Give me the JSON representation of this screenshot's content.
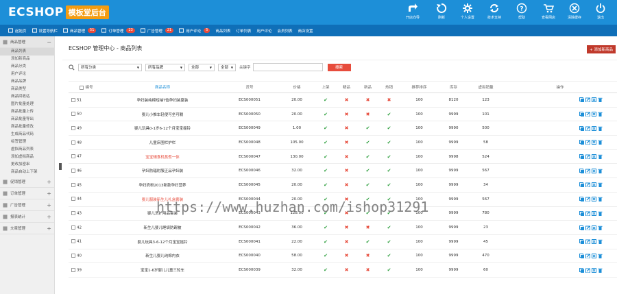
{
  "app": {
    "brand": "ECSHOP",
    "tag": "模板堂后台"
  },
  "top_buttons": [
    {
      "label": "开店向导",
      "icon": "share-icon"
    },
    {
      "label": "刷新",
      "icon": "refresh-icon"
    },
    {
      "label": "个人设置",
      "icon": "gear-icon"
    },
    {
      "label": "技术支持",
      "icon": "sync-icon"
    },
    {
      "label": "帮助",
      "icon": "help-icon"
    },
    {
      "label": "查看网店",
      "icon": "cart-icon"
    },
    {
      "label": "清除缓存",
      "icon": "clear-icon"
    },
    {
      "label": "退出",
      "icon": "power-icon"
    }
  ],
  "nav": [
    {
      "label": "起始页",
      "badge": ""
    },
    {
      "label": "设置导航栏",
      "badge": ""
    },
    {
      "label": "商品管理",
      "badge": "51"
    },
    {
      "label": "订单管理",
      "badge": "23"
    },
    {
      "label": "广告管理",
      "badge": "21"
    },
    {
      "label": "用户评论",
      "badge": "5"
    },
    {
      "label": "商品列表",
      "badge": ""
    },
    {
      "label": "订单列表",
      "badge": ""
    },
    {
      "label": "用户评论",
      "badge": ""
    },
    {
      "label": "会员列表",
      "badge": ""
    },
    {
      "label": "商店设置",
      "badge": ""
    }
  ],
  "sidebar": {
    "groups": [
      {
        "label": "商品管理",
        "expanded": true,
        "sub": [
          "商品列表",
          "添加新商品",
          "商品分类",
          "用户评论",
          "商品品牌",
          "商品类型",
          "商品回收站",
          "图片批量处理",
          "商品批量上传",
          "商品批量导出",
          "商品批量修改",
          "生成商品代码",
          "标签管理",
          "虚拟商品列表",
          "添加虚拟商品",
          "更改加密串",
          "商品自动上下架"
        ]
      },
      {
        "label": "促销管理",
        "expanded": false,
        "sub": []
      },
      {
        "label": "订单管理",
        "expanded": false,
        "sub": []
      },
      {
        "label": "广告管理",
        "expanded": false,
        "sub": []
      },
      {
        "label": "报表统计",
        "expanded": false,
        "sub": []
      },
      {
        "label": "文章管理",
        "expanded": false,
        "sub": []
      }
    ]
  },
  "page": {
    "title": "ECSHOP 管理中心 - 商品列表",
    "add_button": "+ 添加新商品"
  },
  "filter": {
    "category": "所有分类",
    "brand": "所有品牌",
    "status1": "全部",
    "status2": "全部",
    "keyword_label": "关键字",
    "keyword_value": "",
    "search_button": "搜索"
  },
  "table": {
    "headers": [
      "编号",
      "商品名称",
      "货号",
      "价格",
      "上架",
      "精品",
      "新品",
      "热销",
      "推荐排序",
      "库存",
      "虚拟销量",
      "操作"
    ],
    "rows": [
      {
        "id": "51",
        "name": "孕妇装纯棉短袖T恤孕妇装夏装",
        "sn": "ECS000051",
        "price": "20.00",
        "flags": [
          1,
          0,
          0,
          0
        ],
        "sort": "100",
        "stock": "8120",
        "sales": "123",
        "red": false
      },
      {
        "id": "50",
        "name": "婴儿小推车轻便可坐可躺",
        "sn": "ECS000050",
        "price": "20.00",
        "flags": [
          1,
          0,
          0,
          1
        ],
        "sort": "100",
        "stock": "9999",
        "sales": "101",
        "red": false
      },
      {
        "id": "49",
        "name": "婴儿玩具0-1岁6-12个月宝宝摇铃",
        "sn": "ECS000049",
        "price": "1.00",
        "flags": [
          1,
          0,
          1,
          1
        ],
        "sort": "100",
        "stock": "9990",
        "sales": "500",
        "red": false
      },
      {
        "id": "48",
        "name": "儿童床围栏护栏",
        "sn": "ECS000048",
        "price": "105.00",
        "flags": [
          1,
          0,
          1,
          1
        ],
        "sort": "100",
        "stock": "9999",
        "sales": "58",
        "red": false
      },
      {
        "id": "47",
        "name": "宝宝辅食机蒸煮一体",
        "sn": "ECS000047",
        "price": "130.00",
        "flags": [
          1,
          0,
          1,
          1
        ],
        "sort": "100",
        "stock": "9998",
        "sales": "524",
        "red": true
      },
      {
        "id": "46",
        "name": "孕妇防辐射服正品孕妇装",
        "sn": "ECS000046",
        "price": "32.00",
        "flags": [
          1,
          0,
          1,
          1
        ],
        "sort": "100",
        "stock": "9999",
        "sales": "567",
        "red": false
      },
      {
        "id": "45",
        "name": "孕妇奶粉2013新款孕妇营养",
        "sn": "ECS000045",
        "price": "20.00",
        "flags": [
          1,
          0,
          1,
          1
        ],
        "sort": "100",
        "stock": "9999",
        "sales": "34",
        "red": false
      },
      {
        "id": "44",
        "name": "婴儿服装新生儿礼盒套装",
        "sn": "ECS000044",
        "price": "20.00",
        "flags": [
          1,
          0,
          1,
          1
        ],
        "sort": "100",
        "stock": "9999",
        "sales": "567",
        "red": true
      },
      {
        "id": "43",
        "name": "婴儿洗护用品套装",
        "sn": "ECS000043",
        "price": "128.00",
        "flags": [
          1,
          0,
          1,
          1
        ],
        "sort": "100",
        "stock": "9999",
        "sales": "780",
        "red": false
      },
      {
        "id": "42",
        "name": "新生儿婴儿睡袋防踢被",
        "sn": "ECS000042",
        "price": "36.00",
        "flags": [
          1,
          0,
          0,
          1
        ],
        "sort": "100",
        "stock": "9999",
        "sales": "23",
        "red": false
      },
      {
        "id": "41",
        "name": "婴儿玩具3-6-12个月宝宝摇铃",
        "sn": "ECS000041",
        "price": "22.00",
        "flags": [
          1,
          0,
          1,
          1
        ],
        "sort": "100",
        "stock": "9999",
        "sales": "45",
        "red": false
      },
      {
        "id": "40",
        "name": "新生儿婴儿纯棉内衣",
        "sn": "ECS000040",
        "price": "58.00",
        "flags": [
          1,
          0,
          0,
          1
        ],
        "sort": "100",
        "stock": "9999",
        "sales": "470",
        "red": false
      },
      {
        "id": "39",
        "name": "宝宝1-6岁婴儿儿童三轮车",
        "sn": "ECS000039",
        "price": "32.00",
        "flags": [
          1,
          0,
          0,
          1
        ],
        "sort": "100",
        "stock": "9999",
        "sales": "60",
        "red": false
      }
    ]
  },
  "watermark": "https://www.huzhan.com/ishop31291",
  "colors": {
    "topbar": "#1d8fd8",
    "navbar": "#0f6fb8",
    "yes": "#2a9d3a",
    "no": "#e74c3c",
    "accent": "#f39c12"
  }
}
